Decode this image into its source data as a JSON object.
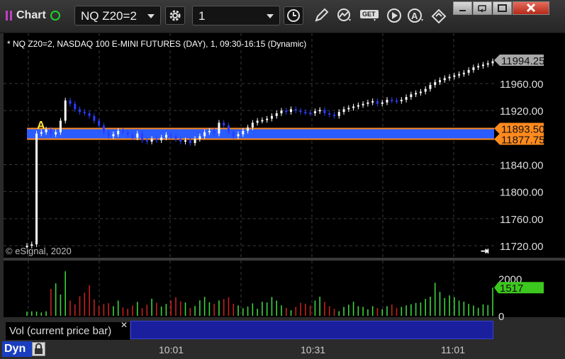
{
  "toolbar": {
    "title": "Chart",
    "symbol_value": "NQ Z20=2",
    "interval_value": "1",
    "get_label": "GET"
  },
  "chart": {
    "symbol_line": "* NQ Z20=2, NASDAQ 100 E-MINI FUTURES (DAY), 1, 09:30-16:15 (Dynamic)",
    "copyright": "© eSignal, 2020",
    "annotation": "A",
    "price_labels": [
      "11960.00",
      "11920.00",
      "11840.00",
      "11800.00",
      "11760.00",
      "11720.00"
    ],
    "last_price": "11994.25",
    "band_high": "11893.50",
    "band_low": "11877.75",
    "vol_labels": [
      "2000",
      "0"
    ],
    "vol_current": "1517",
    "vol_label": "Vol (current price bar)",
    "time_labels": [
      "10:01",
      "10:31",
      "11:01"
    ],
    "dyn_label": "Dyn"
  },
  "colors": {
    "up_bar": "#ffffff",
    "down_bar": "#2a3cff",
    "band": "#2a5cff",
    "band_edge": "#ff8a1e",
    "vol_up": "#3fd23f",
    "vol_down": "#c62020",
    "vol_current_bg": "#3cc81e"
  },
  "chart_data": {
    "type": "candlestick",
    "y_range": [
      11700,
      12010
    ],
    "vol_range": [
      0,
      2900
    ],
    "band": [
      11877.75,
      11893.5
    ],
    "closes": [
      11720,
      11722,
      11886,
      11888,
      11892,
      11885,
      11888,
      11905,
      11935,
      11930,
      11922,
      11918,
      11916,
      11912,
      11905,
      11898,
      11888,
      11882,
      11885,
      11890,
      11888,
      11884,
      11880,
      11886,
      11876,
      11874,
      11878,
      11876,
      11880,
      11884,
      11882,
      11878,
      11874,
      11876,
      11872,
      11878,
      11882,
      11888,
      11890,
      11886,
      11902,
      11898,
      11888,
      11882,
      11885,
      11890,
      11895,
      11902,
      11905,
      11906,
      11908,
      11912,
      11916,
      11920,
      11918,
      11922,
      11920,
      11918,
      11917,
      11916,
      11919,
      11921,
      11916,
      11914,
      11912,
      11918,
      11922,
      11924,
      11926,
      11928,
      11930,
      11932,
      11934,
      11930,
      11932,
      11936,
      11935,
      11934,
      11936,
      11940,
      11944,
      11946,
      11948,
      11952,
      11958,
      11962,
      11965,
      11968,
      11970,
      11972,
      11974,
      11976,
      11980,
      11984,
      11986,
      11988,
      11990,
      11993
    ],
    "volumes": [
      220,
      240,
      230,
      180,
      240,
      1450,
      1750,
      1150,
      2400,
      820,
      610,
      1050,
      1250,
      1650,
      880,
      560,
      630,
      680,
      520,
      820,
      450,
      380,
      560,
      750,
      410,
      600,
      920,
      700,
      500,
      640,
      830,
      1000,
      780,
      720,
      420,
      530,
      830,
      1020,
      730,
      640,
      830,
      900,
      990,
      650,
      560,
      410,
      500,
      670,
      380,
      760,
      720,
      1020,
      820,
      560,
      420,
      300,
      480,
      700,
      650,
      560,
      820,
      1030,
      750,
      520,
      380,
      250,
      480,
      600,
      760,
      520,
      480,
      350,
      520,
      420,
      360,
      520,
      610,
      420,
      480,
      560,
      620,
      690,
      720,
      910,
      1030,
      1780,
      1290,
      960,
      1100,
      1000,
      820,
      760,
      640,
      550,
      430,
      620,
      580,
      1517
    ]
  }
}
